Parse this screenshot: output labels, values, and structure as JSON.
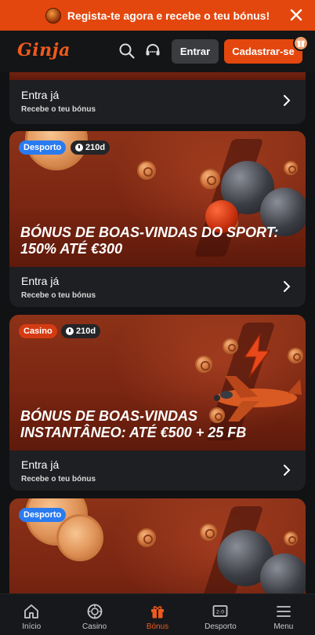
{
  "promo": {
    "text": "Regista-te agora e recebe o teu bónus!",
    "close_icon": "close-icon"
  },
  "header": {
    "logo": "Ginja",
    "login_label": "Entrar",
    "signup_label": "Cadastrar-se"
  },
  "cards": [
    {
      "footer_title": "Entra já",
      "footer_sub": "Recebe o teu bónus"
    },
    {
      "category": "Desporto",
      "days": "210d",
      "title_line1": "BÓNUS DE BOAS-VINDAS DO SPORT:",
      "title_line2": "150% ATÉ €300",
      "footer_title": "Entra já",
      "footer_sub": "Recebe o teu bónus"
    },
    {
      "category": "Casino",
      "days": "210d",
      "title_line1": "BÓNUS DE BOAS-VINDAS",
      "title_line2": "INSTANTÂNEO: ATÉ €500 + 25 FB",
      "footer_title": "Entra já",
      "footer_sub": "Recebe o teu bónus"
    },
    {
      "category": "Desporto"
    }
  ],
  "nav": [
    {
      "label": "Início",
      "icon": "home-icon"
    },
    {
      "label": "Casino",
      "icon": "casino-chip-icon"
    },
    {
      "label": "Bónus",
      "icon": "gift-icon",
      "active": true
    },
    {
      "label": "Desporto",
      "icon": "scoreboard-icon"
    },
    {
      "label": "Menu",
      "icon": "menu-icon"
    }
  ],
  "colors": {
    "accent": "#e3470d",
    "background": "#111214",
    "card": "#1e1f22",
    "badge_desporto": "#2a7bf0",
    "badge_casino": "#d53b12"
  }
}
